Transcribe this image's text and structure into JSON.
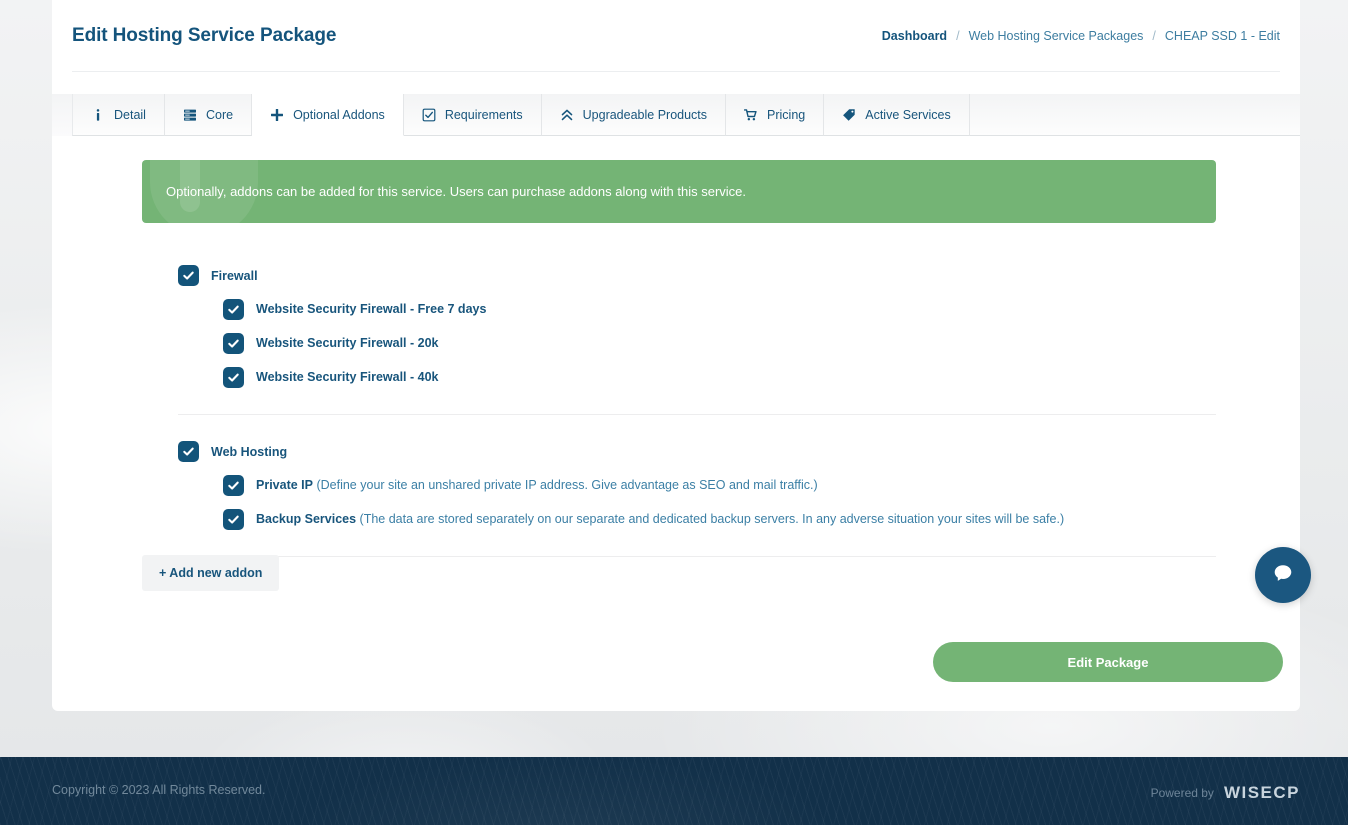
{
  "header": {
    "title": "Edit Hosting Service Package",
    "breadcrumb": [
      {
        "label": "Dashboard",
        "current": false
      },
      {
        "label": "Web Hosting Service Packages",
        "current": false
      },
      {
        "label": "CHEAP SSD 1 - Edit",
        "current": true
      }
    ],
    "separator": "/"
  },
  "tabs": [
    {
      "label": "Detail",
      "icon": "info-icon",
      "active": false
    },
    {
      "label": "Core",
      "icon": "server-icon",
      "active": false
    },
    {
      "label": "Optional Addons",
      "icon": "plus-icon",
      "active": true
    },
    {
      "label": "Requirements",
      "icon": "checkbox-icon",
      "active": false
    },
    {
      "label": "Upgradeable Products",
      "icon": "chevron-up-double-icon",
      "active": false
    },
    {
      "label": "Pricing",
      "icon": "cart-icon",
      "active": false
    },
    {
      "label": "Active Services",
      "icon": "tag-icon",
      "active": false
    }
  ],
  "alert": {
    "text": "Optionally, addons can be added for this service. Users can purchase addons along with this service.",
    "icon": "info-watermark-icon",
    "color": "#74b475"
  },
  "addon_groups": [
    {
      "title": "Firewall",
      "checked": true,
      "items": [
        {
          "name": "Website Security Firewall - Free 7 days",
          "desc": "",
          "checked": true
        },
        {
          "name": "Website Security Firewall - 20k",
          "desc": "",
          "checked": true
        },
        {
          "name": "Website Security Firewall - 40k",
          "desc": "",
          "checked": true
        }
      ]
    },
    {
      "title": "Web Hosting",
      "checked": true,
      "items": [
        {
          "name": "Private IP",
          "desc": "(Define your site an unshared private IP address. Give advantage as SEO and mail traffic.)",
          "checked": true
        },
        {
          "name": "Backup Services",
          "desc": "(The data are stored separately on our separate and dedicated backup servers. In any adverse situation your sites will be safe.)",
          "checked": true
        }
      ]
    }
  ],
  "buttons": {
    "add_addon": "+ Add new addon",
    "submit": "Edit Package"
  },
  "chat": {
    "icon": "chat-bubble-icon",
    "color": "#1b5780"
  },
  "footer": {
    "copyright": "Copyright © 2023 All Rights Reserved.",
    "powered_label": "Powered by",
    "powered_brand": "WISECP"
  },
  "theme": {
    "primary": "#13547a",
    "accent_green": "#74b475",
    "link": "#2d6e96"
  }
}
